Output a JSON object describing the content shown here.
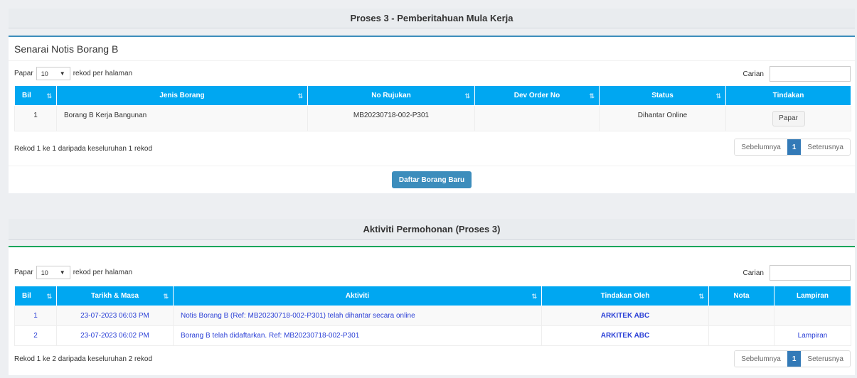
{
  "section1": {
    "title": "Proses 3 - Pemberitahuan Mula Kerja"
  },
  "panel1": {
    "title": "Senarai Notis Borang B",
    "length": {
      "prefix": "Papar",
      "value": "10",
      "suffix": "rekod per halaman"
    },
    "search_label": "Carian",
    "columns": [
      "Bil",
      "Jenis Borang",
      "No Rujukan",
      "Dev Order No",
      "Status",
      "Tindakan"
    ],
    "rows": [
      {
        "bil": "1",
        "jenis": "Borang B Kerja Bangunan",
        "rujukan": "MB20230718-002-P301",
        "dev": "",
        "status": "Dihantar Online",
        "action": "Papar"
      }
    ],
    "info": "Rekod 1 ke 1 daripada keseluruhan 1 rekod",
    "pager": {
      "prev": "Sebelumnya",
      "page": "1",
      "next": "Seterusnya"
    },
    "new_button": "Daftar Borang Baru"
  },
  "section2": {
    "title": "Aktiviti Permohonan (Proses 3)"
  },
  "panel2": {
    "length": {
      "prefix": "Papar",
      "value": "10",
      "suffix": "rekod per halaman"
    },
    "search_label": "Carian",
    "columns": [
      "Bil",
      "Tarikh & Masa",
      "Aktiviti",
      "Tindakan Oleh",
      "Nota",
      "Lampiran"
    ],
    "rows": [
      {
        "bil": "1",
        "tarikh": "23-07-2023 06:03 PM",
        "aktiviti": "Notis Borang B (Ref: MB20230718-002-P301) telah dihantar secara online",
        "oleh": "ARKITEK ABC",
        "nota": "",
        "lampiran": ""
      },
      {
        "bil": "2",
        "tarikh": "23-07-2023 06:02 PM",
        "aktiviti": "Borang B telah didaftarkan. Ref: MB20230718-002-P301",
        "oleh": "ARKITEK ABC",
        "nota": "",
        "lampiran": "Lampiran"
      }
    ],
    "info": "Rekod 1 ke 2 daripada keseluruhan 2 rekod",
    "pager": {
      "prev": "Sebelumnya",
      "page": "1",
      "next": "Seterusnya"
    }
  },
  "colors": {
    "header": "#00a7f1",
    "primary": "#3c8dbc",
    "link": "#2a3fd6",
    "green_border": "#00a65a"
  },
  "icons": {
    "sort": "sort-icon",
    "dropdown": "chevron-down-icon"
  }
}
